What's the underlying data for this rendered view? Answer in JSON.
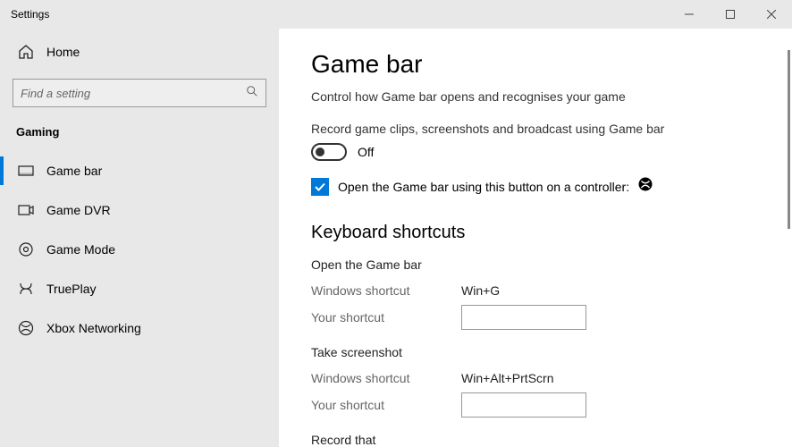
{
  "window": {
    "title": "Settings"
  },
  "sidebar": {
    "home_label": "Home",
    "search_placeholder": "Find a setting",
    "section_label": "Gaming",
    "items": [
      {
        "label": "Game bar"
      },
      {
        "label": "Game DVR"
      },
      {
        "label": "Game Mode"
      },
      {
        "label": "TruePlay"
      },
      {
        "label": "Xbox Networking"
      }
    ]
  },
  "main": {
    "title": "Game bar",
    "subtitle": "Control how Game bar opens and recognises your game",
    "record_label": "Record game clips, screenshots and broadcast using Game bar",
    "toggle_state": "Off",
    "controller_label": "Open the Game bar using this button on a controller:",
    "shortcuts_heading": "Keyboard shortcuts",
    "shortcut_groups": [
      {
        "title": "Open the Game bar",
        "win_label": "Windows shortcut",
        "win_value": "Win+G",
        "your_label": "Your shortcut"
      },
      {
        "title": "Take screenshot",
        "win_label": "Windows shortcut",
        "win_value": "Win+Alt+PrtScrn",
        "your_label": "Your shortcut"
      },
      {
        "title": "Record that"
      }
    ]
  }
}
